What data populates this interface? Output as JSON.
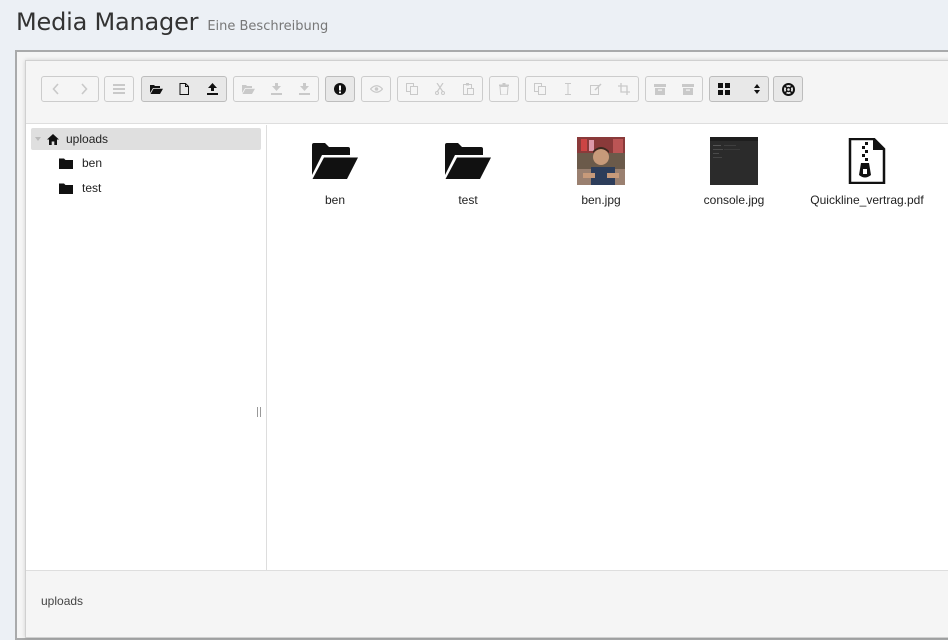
{
  "header": {
    "title": "Media Manager",
    "subtitle": "Eine Beschreibung"
  },
  "toolbar": {
    "groups": [
      {
        "name": "history",
        "buttons": [
          {
            "icon": "back-icon",
            "enabled": false
          },
          {
            "icon": "forward-icon",
            "enabled": false
          }
        ]
      },
      {
        "name": "places",
        "buttons": [
          {
            "icon": "list-icon",
            "enabled": false
          }
        ]
      },
      {
        "name": "create",
        "buttons": [
          {
            "icon": "open-folder-icon",
            "enabled": true
          },
          {
            "icon": "new-file-icon",
            "enabled": true
          },
          {
            "icon": "upload-icon",
            "enabled": true
          }
        ]
      },
      {
        "name": "transfer",
        "buttons": [
          {
            "icon": "open-folder-icon",
            "enabled": false
          },
          {
            "icon": "download-icon",
            "enabled": false
          },
          {
            "icon": "download-icon",
            "enabled": false
          }
        ]
      },
      {
        "name": "info",
        "buttons": [
          {
            "icon": "info-icon",
            "enabled": true
          }
        ]
      },
      {
        "name": "preview",
        "buttons": [
          {
            "icon": "eye-icon",
            "enabled": false
          }
        ]
      },
      {
        "name": "clipboard",
        "buttons": [
          {
            "icon": "copy-icon",
            "enabled": false
          },
          {
            "icon": "cut-icon",
            "enabled": false
          },
          {
            "icon": "paste-icon",
            "enabled": false
          }
        ]
      },
      {
        "name": "delete",
        "buttons": [
          {
            "icon": "trash-icon",
            "enabled": false
          }
        ]
      },
      {
        "name": "edit",
        "buttons": [
          {
            "icon": "duplicate-icon",
            "enabled": false
          },
          {
            "icon": "rename-icon",
            "enabled": false
          },
          {
            "icon": "edit-icon",
            "enabled": false
          },
          {
            "icon": "crop-icon",
            "enabled": false
          }
        ]
      },
      {
        "name": "archive",
        "buttons": [
          {
            "icon": "archive-icon",
            "enabled": false
          },
          {
            "icon": "extract-icon",
            "enabled": false
          }
        ]
      },
      {
        "name": "view",
        "buttons": [
          {
            "icon": "grid-icon",
            "enabled": true
          },
          {
            "icon": "sort-icon",
            "enabled": true
          }
        ]
      },
      {
        "name": "help",
        "buttons": [
          {
            "icon": "help-icon",
            "enabled": true
          }
        ]
      }
    ]
  },
  "tree": {
    "root": {
      "label": "uploads",
      "icon": "home-icon"
    },
    "children": [
      {
        "label": "ben",
        "icon": "folder-icon"
      },
      {
        "label": "test",
        "icon": "folder-icon"
      }
    ]
  },
  "files": [
    {
      "name": "ben",
      "kind": "folder",
      "icon": "open-folder-icon"
    },
    {
      "name": "test",
      "kind": "folder",
      "icon": "open-folder-icon"
    },
    {
      "name": "ben.jpg",
      "kind": "image",
      "icon": "photo-thumbnail"
    },
    {
      "name": "console.jpg",
      "kind": "image",
      "icon": "console-thumbnail"
    },
    {
      "name": "Quickline_vertrag.pdf",
      "kind": "archive",
      "icon": "zip-file-icon"
    }
  ],
  "statusbar": {
    "path": "uploads"
  }
}
